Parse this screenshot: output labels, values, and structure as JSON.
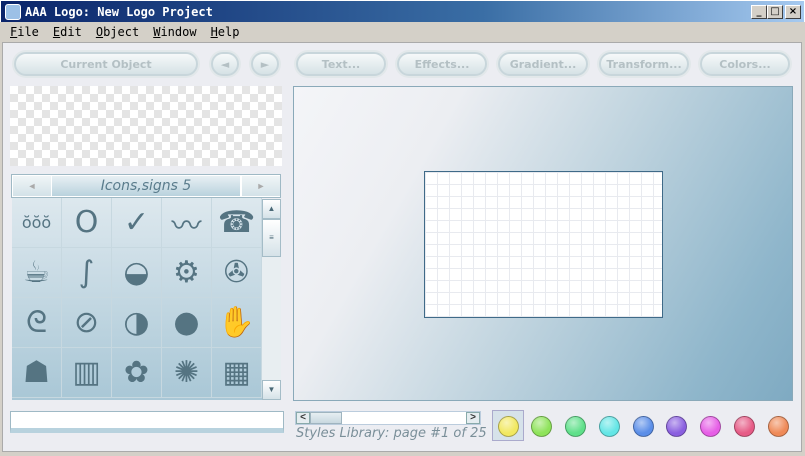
{
  "window": {
    "title": "AAA Logo: New Logo Project",
    "minimize": "_",
    "maximize": "□",
    "close": "×"
  },
  "menu": [
    "File",
    "Edit",
    "Object",
    "Window",
    "Help"
  ],
  "toolbar": {
    "current_object": "Current Object",
    "prev": "◄",
    "next": "►",
    "text": "Text...",
    "effects": "Effects...",
    "gradient": "Gradient...",
    "transform": "Transform...",
    "colors": "Colors..."
  },
  "library": {
    "category": "Icons,signs 5",
    "prev": "◄",
    "next": "►",
    "icons": [
      {
        "name": "waves-people-icon",
        "glyph": "ŏŏŏ"
      },
      {
        "name": "swirl-ring-icon",
        "glyph": "O"
      },
      {
        "name": "swoosh-icon",
        "glyph": "✓"
      },
      {
        "name": "wave-line-icon",
        "glyph": "〰"
      },
      {
        "name": "telephone-icon",
        "glyph": "☎"
      },
      {
        "name": "hot-coffee-icon",
        "glyph": "☕"
      },
      {
        "name": "s-curve-icon",
        "glyph": "∫"
      },
      {
        "name": "cup-icon",
        "glyph": "◒"
      },
      {
        "name": "gears-icon",
        "glyph": "⚙"
      },
      {
        "name": "pinwheel-icon",
        "glyph": "✇"
      },
      {
        "name": "curl-wave-icon",
        "glyph": "ᘓ"
      },
      {
        "name": "no-smoking-icon",
        "glyph": "⊘"
      },
      {
        "name": "moon-phase-icon",
        "glyph": "◑"
      },
      {
        "name": "globe-icon",
        "glyph": "●"
      },
      {
        "name": "handprint-icon",
        "glyph": "✋"
      },
      {
        "name": "turtle-icon",
        "glyph": "☗"
      },
      {
        "name": "elevator-people-icon",
        "glyph": "▥"
      },
      {
        "name": "clover-icon",
        "glyph": "✿"
      },
      {
        "name": "splat-icon",
        "glyph": "✺"
      },
      {
        "name": "brick-wall-icon",
        "glyph": "▦"
      }
    ]
  },
  "name_input": {
    "value": ""
  },
  "styles": {
    "label": "Styles Library: page #1 of 25",
    "page": 1,
    "total": 25,
    "swatches": [
      "#f1e860",
      "#8ee35a",
      "#5fe08a",
      "#64e6e6",
      "#5b8ee8",
      "#8a5fe0",
      "#e65ee6",
      "#e65b86",
      "#ef8a58"
    ]
  }
}
